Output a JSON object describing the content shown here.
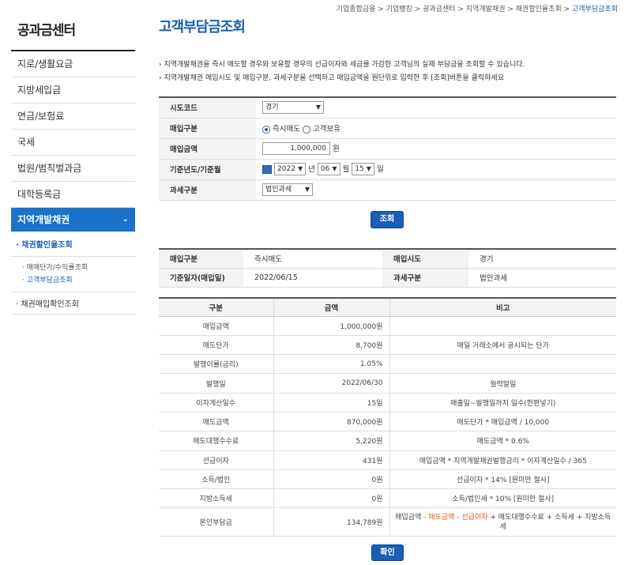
{
  "breadcrumb": {
    "items": [
      "기업종합금융 >",
      "기업뱅킹 >",
      "공과금센터 >",
      "지역개발채권 >",
      "채권할인율조회 >"
    ],
    "current": "고객부담금조회"
  },
  "sidebar": {
    "title": "공과금센터",
    "items": [
      "지로/생활요금",
      "지방세입금",
      "연금/보험료",
      "국세",
      "법원/범칙벌과금",
      "대학등록금"
    ],
    "active": "지역개발채권",
    "sub1": "· 채권할인율조회",
    "subsub": [
      "· 매매단가/수익률조회",
      "· 고객부담금조회"
    ],
    "sub2": "· 채권매입확인조회"
  },
  "page": {
    "title": "고객부담금조회",
    "notes": [
      "› 지역개발채권을 즉시 매도할 경우와 보유할 경우의 선급이자와 세금를 가감한 고객님의 실제 부담금을 조회할 수 있습니다.",
      "› 지역개발채권 매입시도 및 매입구분, 과세구분을 선택하고 매입금액을 원단위로 입력한 후 [조회]버튼을 클릭하세요"
    ]
  },
  "form": {
    "labels": {
      "city": "시도코드",
      "type": "매입구분",
      "amount": "매입금액",
      "date": "기준년도/기준월",
      "tax": "과세구분"
    },
    "city": "경기",
    "type_opt1": "즉시매도",
    "type_opt2": "고객보유",
    "amount": "1,000,000",
    "won": "원",
    "year": "2022",
    "year_unit": "년",
    "month": "06",
    "month_unit": "월",
    "day": "15",
    "day_unit": "일",
    "tax": "법인과세",
    "search_btn": "조회"
  },
  "result": {
    "type_lbl": "매입구분",
    "type_val": "즉시매도",
    "city_lbl": "매입시도",
    "city_val": "경기",
    "date_lbl": "기준일자(매입일)",
    "date_val": "2022/06/15",
    "tax_lbl": "과세구분",
    "tax_val": "법인과세"
  },
  "detail": {
    "headers": [
      "구분",
      "금액",
      "비고"
    ],
    "rows": [
      {
        "c1": "매입금액",
        "c2": "1,000,000원",
        "c3": ""
      },
      {
        "c1": "매도단가",
        "c2": "8,700원",
        "c3": "매일 거래소에서 공시되는 단가"
      },
      {
        "c1": "발행이률(금리)",
        "c2": "1.05%",
        "c3": ""
      },
      {
        "c1": "발행일",
        "c2": "2022/06/30",
        "c3": "월력말일"
      },
      {
        "c1": "이자계산일수",
        "c2": "15일",
        "c3": "매출일~발행일까지 일수(한편넣기)"
      },
      {
        "c1": "매도금액",
        "c2": "870,000원",
        "c3": "매도단가 * 매입금액 / 10,000"
      },
      {
        "c1": "매도대행수수료",
        "c2": "5,220원",
        "c3": "매도금액 * 0.6%"
      },
      {
        "c1": "선급이자",
        "c2": "431원",
        "c3": "매입금액 * 지역개발채권발행금리 * 이자계산일수 / 365"
      },
      {
        "c1": "소득/법인",
        "c2": "0원",
        "c3": "선급이자 * 14% [원미만 절사]"
      },
      {
        "c1": "지방소득세",
        "c2": "0원",
        "c3": "소득/법인세 * 10% [원미만 절사]"
      },
      {
        "c1": "본인부담금",
        "c2": "134,789원",
        "c3a": "매입금액 ",
        "c3b": "- 매도금액 - 선급이자",
        "c3c": " + 매도대행수수료 + 소득세 + 지방소득세"
      }
    ]
  },
  "confirm_btn": "확인",
  "colors": {
    "accent": "#1a5fb4",
    "highlight": "#e8541b"
  }
}
